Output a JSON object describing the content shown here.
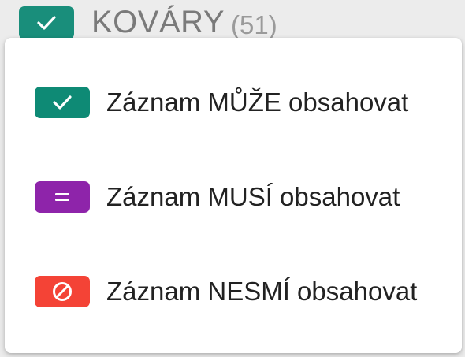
{
  "header": {
    "title": "KOVÁRY",
    "count": "(51)",
    "badge_icon": "check-icon",
    "badge_color": "#0e8a75"
  },
  "menu": {
    "items": [
      {
        "label": "Záznam MŮŽE obsahovat",
        "icon": "check-icon",
        "color": "#0e8a75"
      },
      {
        "label": "Záznam MUSÍ obsahovat",
        "icon": "equals-icon",
        "color": "#8e24aa"
      },
      {
        "label": "Záznam NESMÍ obsahovat",
        "icon": "prohibited-icon",
        "color": "#f44336"
      }
    ]
  }
}
